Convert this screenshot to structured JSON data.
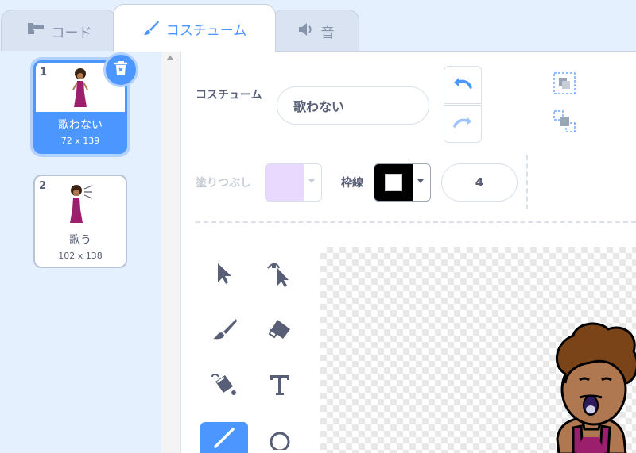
{
  "tabs": [
    {
      "label": "コード",
      "icon": "code-blocks-icon"
    },
    {
      "label": "コスチューム",
      "icon": "brush-icon"
    },
    {
      "label": "音",
      "icon": "speaker-icon"
    }
  ],
  "costumes": [
    {
      "number": "1",
      "name": "歌わない",
      "size": "72 x 139",
      "selected": true
    },
    {
      "number": "2",
      "name": "歌う",
      "size": "102 x 138",
      "selected": false
    }
  ],
  "editor": {
    "costume_label": "コスチューム",
    "costume_name": "歌わない",
    "fill_label": "塗りつぶし",
    "fill_color": "#e9d9ff",
    "stroke_label": "枠線",
    "stroke_color": "#000000",
    "stroke_width": "4"
  },
  "colors": {
    "accent": "#4c97ff",
    "panel_bg": "#e5f0ff",
    "text": "#575e75"
  }
}
